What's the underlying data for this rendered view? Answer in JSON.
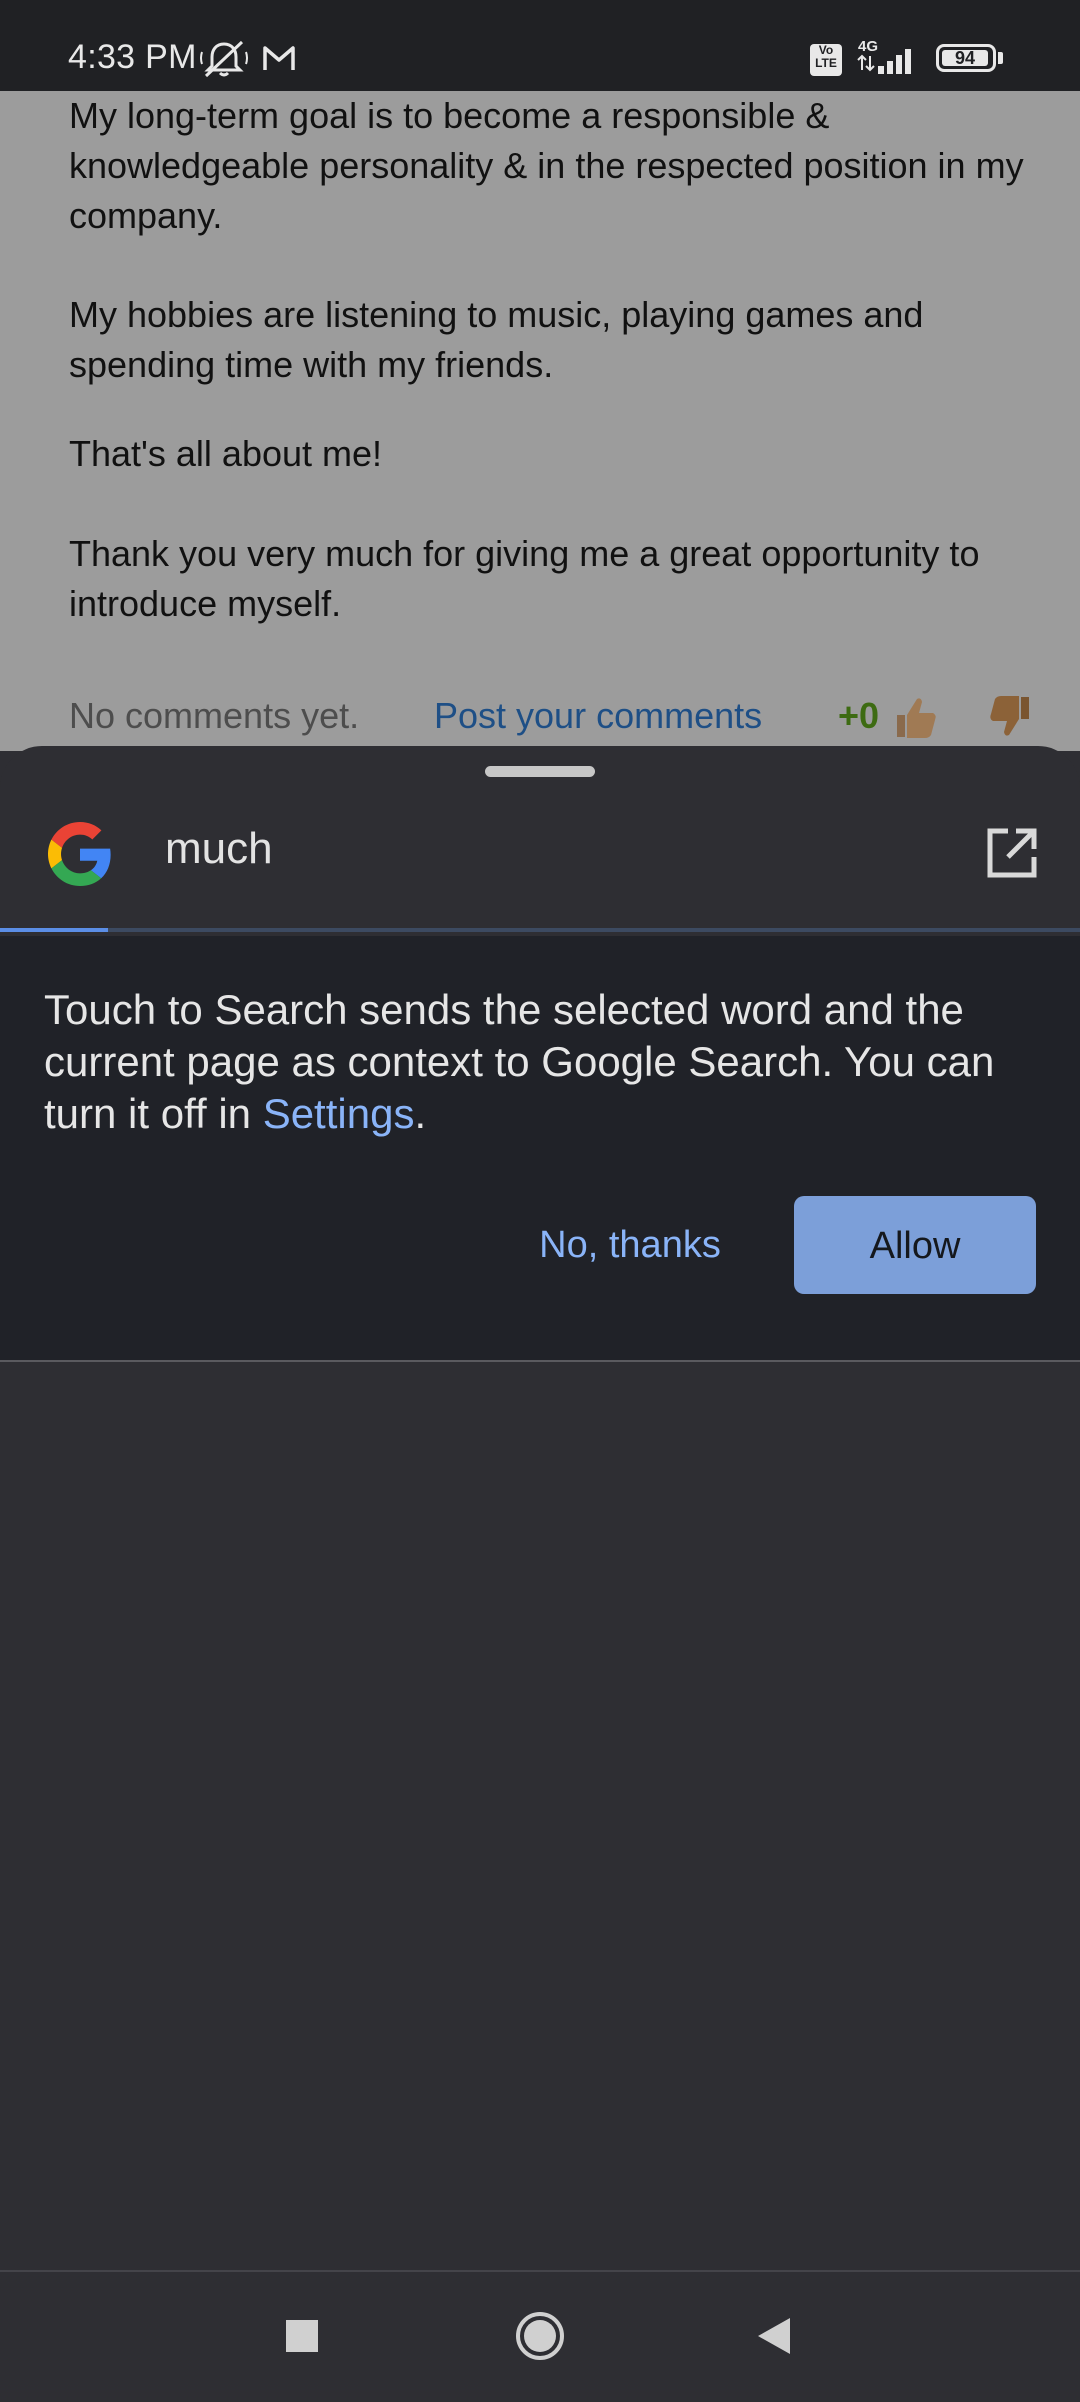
{
  "status_bar": {
    "time": "4:33 PM",
    "icons": [
      "mute-bell-icon",
      "gmail-icon",
      "volte-icon",
      "4g-signal-icon",
      "battery-icon"
    ],
    "volte_label": "Vo\nLTE",
    "network": "4G",
    "battery": "94"
  },
  "article": {
    "paragraphs": [
      "My long-term goal is to become a responsible & knowledgeable personality & in the respected position in my company.",
      "My hobbies are listening to music, playing games and spending time with my friends.",
      "That's all about me!",
      "Thank you very much for giving me a great opportunity to introduce myself."
    ],
    "no_comments": "No comments yet.",
    "post_comments": "Post your comments",
    "vote_count": "+0"
  },
  "search_sheet": {
    "query": "much",
    "progress_fraction": 0.1,
    "promo_text_before": "Touch to Search sends the selected word and the current page as context to Google Search. You can turn it off in ",
    "settings_link": "Settings",
    "promo_text_after": ".",
    "no_thanks": "No, thanks",
    "allow": "Allow",
    "colors": {
      "link": "#8ab4f8",
      "allow_bg": "#7c9fd9",
      "progress": "#5b8ee6"
    }
  },
  "nav_bar": {
    "icons": [
      "recents-square-icon",
      "home-circle-icon",
      "back-triangle-icon"
    ]
  }
}
